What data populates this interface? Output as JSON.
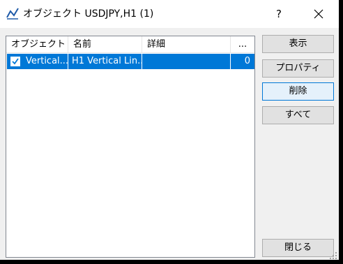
{
  "window": {
    "title": "オブジェクト USDJPY,H1 (1)",
    "help_label": "?",
    "app_icon": "chart-line-icon",
    "close_icon": "close-icon"
  },
  "list": {
    "columns": [
      "オブジェクト",
      "名前",
      "詳細",
      "..."
    ],
    "rows": [
      {
        "checked": true,
        "object": "Vertical...",
        "name": "H1 Vertical Lin...",
        "detail": "",
        "count": "0",
        "selected": true
      }
    ]
  },
  "buttons": {
    "show": "表示",
    "properties": "プロパティ",
    "delete": "削除",
    "all": "すべて",
    "close": "閉じる"
  },
  "colors": {
    "selection": "#0078d7",
    "button_face": "#e1e1e1",
    "focus_border": "#0078d7",
    "window_bg": "#f0f0f0"
  }
}
